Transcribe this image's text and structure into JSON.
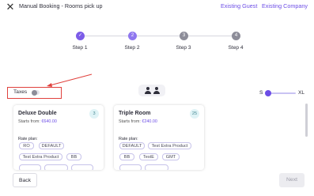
{
  "header": {
    "title": "Manual Booking - Rooms pick up",
    "existing_guest": "Existing Guest",
    "existing_company": "Existing Company"
  },
  "stepper": {
    "steps": [
      {
        "label": "Step 1",
        "marker": "✓",
        "state": "done"
      },
      {
        "label": "Step 2",
        "marker": "2",
        "state": "current"
      },
      {
        "label": "Step 3",
        "marker": "3",
        "state": "upcoming"
      },
      {
        "label": "Step 4",
        "marker": "4",
        "state": "upcoming"
      }
    ]
  },
  "filters": {
    "taxes_label": "Taxes",
    "taxes_enabled": false,
    "size_min_label": "S",
    "size_max_label": "XL"
  },
  "rooms": [
    {
      "name": "Deluxe Double",
      "count": "3",
      "starts_from_label": "Starts from:",
      "price": "€640.00",
      "rate_plan_label": "Rate plan:",
      "rate_plans": [
        "RO",
        "DEFAULT",
        "Test Extra Product",
        "BB"
      ]
    },
    {
      "name": "Triple Room",
      "count": "25",
      "starts_from_label": "Starts from:",
      "price": "€240.00",
      "rate_plan_label": "Rate plan:",
      "rate_plans": [
        "DEFAULT",
        "Test Extra Product",
        "BB",
        "TestE",
        "GMT"
      ]
    }
  ],
  "footer": {
    "back_label": "Back",
    "next_label": "Next"
  },
  "colors": {
    "accent": "#6c4de6",
    "annotation_red": "#e0413d",
    "step_done": "#7c5ce8",
    "step_current": "#8f77ef",
    "step_upcoming": "#8d8d99"
  }
}
